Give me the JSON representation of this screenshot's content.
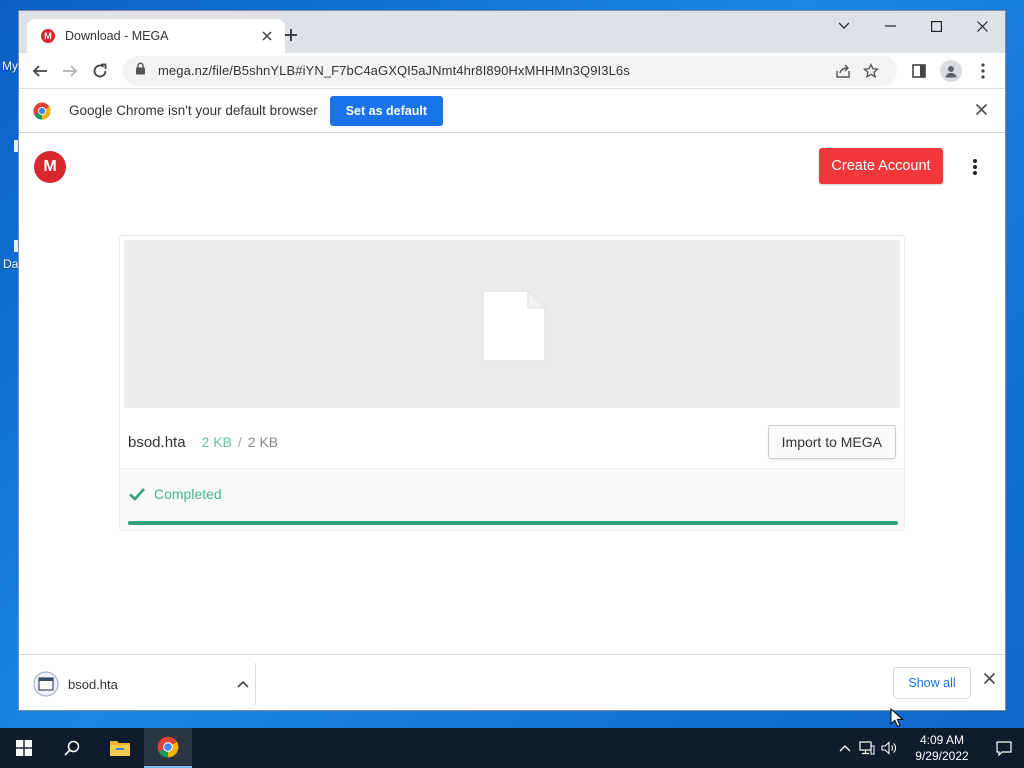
{
  "desktop": {
    "icon_labels": [
      "My",
      "Da"
    ]
  },
  "browser": {
    "tab": {
      "title": "Download - MEGA",
      "favicon_letter": "M"
    },
    "address": {
      "url": "mega.nz/file/B5shnYLB#iYN_F7bC4aGXQI5aJNmt4hr8I890HxMHHMn3Q9I3L6s"
    },
    "infobar": {
      "message": "Google Chrome isn't your default browser",
      "button": "Set as default"
    }
  },
  "page": {
    "logo_letter": "M",
    "create_account": "Create Account",
    "file": {
      "name": "bsod.hta",
      "size_done": "2 KB",
      "separator": "/",
      "size_total": "2 KB",
      "import_button": "Import to MEGA",
      "status": "Completed",
      "progress_fraction": 1.0
    }
  },
  "downloads_shelf": {
    "item_name": "bsod.hta",
    "show_all": "Show all"
  },
  "taskbar": {
    "time": "4:09 AM",
    "date": "9/29/2022"
  },
  "colors": {
    "mega_red": "#d9272e",
    "create_button": "#f0373a",
    "chrome_blue": "#1a73e8",
    "progress_green": "#2fa37c",
    "status_green": "#45b38e"
  }
}
